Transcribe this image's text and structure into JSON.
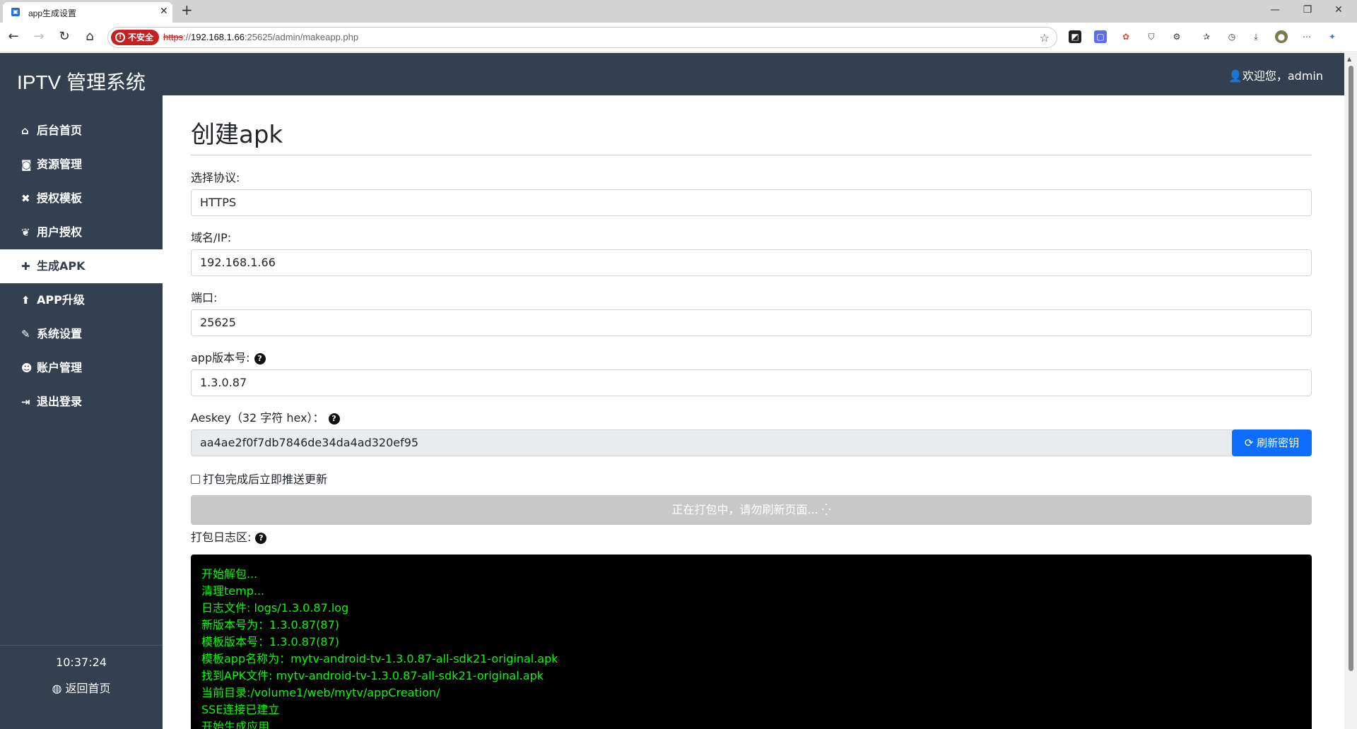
{
  "browser": {
    "tab_title": "app生成设置",
    "tab_close": "✕",
    "new_tab": "+",
    "insecure_label": "不安全",
    "url_protocol": "https",
    "url_sep": "://",
    "url_host": "192.168.1.66",
    "url_path": ":25625/admin/makeapp.php"
  },
  "app": {
    "brand": "IPTV 管理系统",
    "welcome": "欢迎您，admin"
  },
  "sidebar": {
    "items": [
      {
        "icon": "home-icon",
        "label": "后台首页",
        "active": false
      },
      {
        "icon": "rss-icon",
        "label": "资源管理",
        "active": false
      },
      {
        "icon": "tools-icon",
        "label": "授权模板",
        "active": false
      },
      {
        "icon": "leaf-icon",
        "label": "用户授权",
        "active": false
      },
      {
        "icon": "puzzle-icon",
        "label": "生成APK",
        "active": true
      },
      {
        "icon": "upload-circle-icon",
        "label": "APP升级",
        "active": false
      },
      {
        "icon": "wrench-icon",
        "label": "系统设置",
        "active": false
      },
      {
        "icon": "users-icon",
        "label": "账户管理",
        "active": false
      },
      {
        "icon": "logout-icon",
        "label": "退出登录",
        "active": false
      }
    ],
    "clock": "10:37:24",
    "home_link": "返回首页"
  },
  "form": {
    "title": "创建apk",
    "protocol_label": "选择协议:",
    "protocol_value": "HTTPS",
    "host_label": "域名/IP:",
    "host_value": "192.168.1.66",
    "port_label": "端口:",
    "port_value": "25625",
    "version_label": "app版本号:",
    "version_value": "1.3.0.87",
    "aeskey_label": "Aeskey（32 字符 hex）：",
    "aeskey_value": "aa4ae2f0f7db7846de34da4ad320ef95",
    "refresh_button": "刷新密钥",
    "push_checkbox_label": "打包完成后立即推送更新",
    "build_button": "正在打包中，请勿刷新页面... ⁛",
    "log_label": "打包日志区:"
  },
  "log_lines": [
    "开始解包...",
    "清理temp...",
    "日志文件: logs/1.3.0.87.log",
    "新版本号为：1.3.0.87(87)",
    "模板版本号：1.3.0.87(87)",
    "模板app名称为：mytv-android-tv-1.3.0.87-all-sdk21-original.apk",
    "找到APK文件: mytv-android-tv-1.3.0.87-all-sdk21-original.apk",
    "当前目录:/volume1/web/mytv/appCreation/",
    "SSE连接已建立",
    "开始生成应用..."
  ],
  "colors": {
    "sidebar_bg": "#343f4f",
    "primary": "#0d6efd",
    "log_text": "#00ff00",
    "insecure": "#c5221f"
  }
}
